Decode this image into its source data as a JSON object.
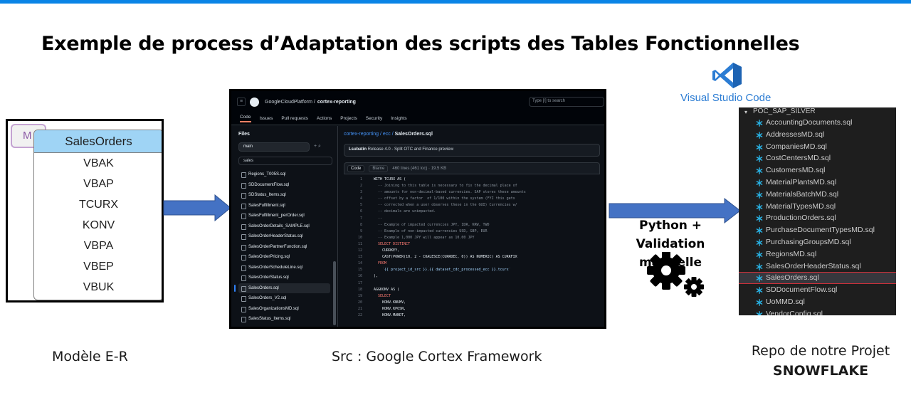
{
  "slide": {
    "title": "Exemple de process d’Adaptation des scripts des Tables Fonctionnelles"
  },
  "er": {
    "badge": "M",
    "table": "SalesOrders",
    "rows": [
      "VBAK",
      "VBAP",
      "TCURX",
      "KONV",
      "VBPA",
      "VBEP",
      "VBUK"
    ],
    "caption": "Modèle E-R"
  },
  "github": {
    "org": "GoogleCloudPlatform /",
    "repo": "cortex-reporting",
    "search": "Type [/] to search",
    "nav": [
      "Code",
      "Issues",
      "Pull requests",
      "Actions",
      "Projects",
      "Security",
      "Insights"
    ],
    "files_title": "Files",
    "branch": "main",
    "filter": "sales",
    "files": [
      "Regions_T005S.sql",
      "SDDocumentFlow.sql",
      "SDStatus_Items.sql",
      "SalesFulfillment.sql",
      "SalesFulfillment_perOrder.sql",
      "SalesOrderDetails_SAMPLE.sql",
      "SalesOrderHeaderStatus.sql",
      "SalesOrderPartnerFunction.sql",
      "SalesOrderPricing.sql",
      "SalesOrderScheduleLine.sql",
      "SalesOrderStatus.sql",
      "SalesOrders.sql",
      "SalesOrders_V2.sql",
      "SalesOrganizationsMD.sql",
      "SalesStatus_Items.sql"
    ],
    "path_prefix": "cortex-reporting / ecc /",
    "path_file": "SalesOrders.sql",
    "commit_user": "Lsubatin",
    "commit_msg": "Release 4.0 - Split OTC and Finance preview",
    "tab_code": "Code",
    "tab_blame": "Blame",
    "file_info": "460 lines (461 loc) · 19.5 KB",
    "code": [
      {
        "n": "1",
        "t": "WITH TCURX AS (",
        "c": "c-txt"
      },
      {
        "n": "2",
        "t": "  -- Joining to this table is necessary to fix the decimal place of",
        "c": "c-com"
      },
      {
        "n": "3",
        "t": "  -- amounts for non-decimal-based currencies. SAP stores these amounts",
        "c": "c-com"
      },
      {
        "n": "4",
        "t": "  -- offset by a factor  of 1/100 within the system (FYI this gets",
        "c": "c-com"
      },
      {
        "n": "5",
        "t": "  -- corrected when a user observes these in the GUI) Currencies w/",
        "c": "c-com"
      },
      {
        "n": "6",
        "t": "  -- decimals are unimpacted.",
        "c": "c-com"
      },
      {
        "n": "7",
        "t": "  --",
        "c": "c-com"
      },
      {
        "n": "8",
        "t": "  -- Example of impacted currencies JPY, IDR, KRW, TWD",
        "c": "c-com"
      },
      {
        "n": "9",
        "t": "  -- Example of non-impacted currencies USD, GBP, EUR",
        "c": "c-com"
      },
      {
        "n": "10",
        "t": "  -- Example 1,000 JPY will appear as 10.00 JPY",
        "c": "c-com"
      },
      {
        "n": "11",
        "t": "  SELECT DISTINCT",
        "c": "c-kw"
      },
      {
        "n": "12",
        "t": "    CURRKEY,",
        "c": "c-txt"
      },
      {
        "n": "13",
        "t": "    CAST(POWER(10, 2 - COALESCE(CURRDEC, 0)) AS NUMERIC) AS CURRFIX",
        "c": "c-txt"
      },
      {
        "n": "14",
        "t": "  FROM",
        "c": "c-kw"
      },
      {
        "n": "15",
        "t": "    `{{ project_id_src }}.{{ dataset_cdc_processed_ecc }}.tcurx`",
        "c": "c-str"
      },
      {
        "n": "16",
        "t": "),",
        "c": "c-txt"
      },
      {
        "n": "17",
        "t": "",
        "c": "c-txt"
      },
      {
        "n": "18",
        "t": "AGGKONV AS (",
        "c": "c-txt"
      },
      {
        "n": "19",
        "t": "  SELECT",
        "c": "c-kw"
      },
      {
        "n": "20",
        "t": "    KONV.KNUMV,",
        "c": "c-txt"
      },
      {
        "n": "21",
        "t": "    KONV.KPOSN,",
        "c": "c-txt"
      },
      {
        "n": "22",
        "t": "    KONV.MANDT,",
        "c": "c-txt"
      }
    ],
    "caption": "Src : Google Cortex Framework"
  },
  "process": {
    "line1": "Python +",
    "line2": "Validation  manuelle",
    "gear_icon": "gears-icon"
  },
  "vscode": {
    "label": "Visual Studio Code",
    "folder": "POC_SAP_SILVER",
    "files": [
      "AccountingDocuments.sql",
      "AddressesMD.sql",
      "CompaniesMD.sql",
      "CostCentersMD.sql",
      "CustomersMD.sql",
      "MaterialPlantsMD.sql",
      "MaterialsBatchMD.sql",
      "MaterialTypesMD.sql",
      "ProductionOrders.sql",
      "PurchaseDocumentTypesMD.sql",
      "PurchasingGroupsMD.sql",
      "RegionsMD.sql",
      "SalesOrderHeaderStatus.sql",
      "SalesOrders.sql",
      "SDDocumentFlow.sql",
      "UoMMD.sql",
      "VendorConfig.sql"
    ],
    "selected": "SalesOrders.sql",
    "caption_line1": "Repo de notre Projet",
    "caption_line2": "SNOWFLAKE"
  },
  "colors": {
    "accent": "#0a84e6",
    "arrow_fill": "#4472c4",
    "er_header": "#9fd4f5",
    "highlight_border": "#d0303a"
  }
}
